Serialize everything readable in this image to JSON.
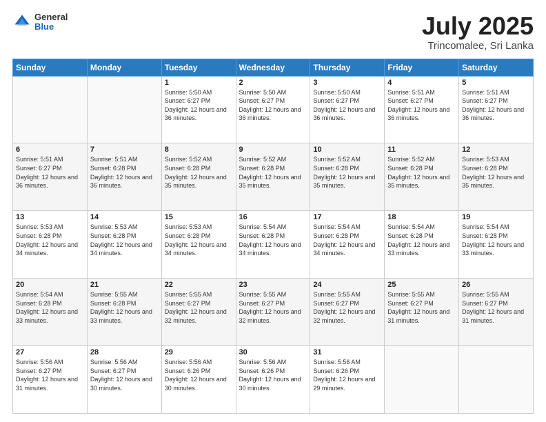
{
  "header": {
    "logo": {
      "line1": "General",
      "line2": "Blue"
    },
    "title": "July 2025",
    "subtitle": "Trincomalee, Sri Lanka"
  },
  "weekdays": [
    "Sunday",
    "Monday",
    "Tuesday",
    "Wednesday",
    "Thursday",
    "Friday",
    "Saturday"
  ],
  "weeks": [
    [
      {
        "day": "",
        "info": ""
      },
      {
        "day": "",
        "info": ""
      },
      {
        "day": "1",
        "info": "Sunrise: 5:50 AM\nSunset: 6:27 PM\nDaylight: 12 hours and 36 minutes."
      },
      {
        "day": "2",
        "info": "Sunrise: 5:50 AM\nSunset: 6:27 PM\nDaylight: 12 hours and 36 minutes."
      },
      {
        "day": "3",
        "info": "Sunrise: 5:50 AM\nSunset: 6:27 PM\nDaylight: 12 hours and 36 minutes."
      },
      {
        "day": "4",
        "info": "Sunrise: 5:51 AM\nSunset: 6:27 PM\nDaylight: 12 hours and 36 minutes."
      },
      {
        "day": "5",
        "info": "Sunrise: 5:51 AM\nSunset: 6:27 PM\nDaylight: 12 hours and 36 minutes."
      }
    ],
    [
      {
        "day": "6",
        "info": "Sunrise: 5:51 AM\nSunset: 6:27 PM\nDaylight: 12 hours and 36 minutes."
      },
      {
        "day": "7",
        "info": "Sunrise: 5:51 AM\nSunset: 6:28 PM\nDaylight: 12 hours and 36 minutes."
      },
      {
        "day": "8",
        "info": "Sunrise: 5:52 AM\nSunset: 6:28 PM\nDaylight: 12 hours and 35 minutes."
      },
      {
        "day": "9",
        "info": "Sunrise: 5:52 AM\nSunset: 6:28 PM\nDaylight: 12 hours and 35 minutes."
      },
      {
        "day": "10",
        "info": "Sunrise: 5:52 AM\nSunset: 6:28 PM\nDaylight: 12 hours and 35 minutes."
      },
      {
        "day": "11",
        "info": "Sunrise: 5:52 AM\nSunset: 6:28 PM\nDaylight: 12 hours and 35 minutes."
      },
      {
        "day": "12",
        "info": "Sunrise: 5:53 AM\nSunset: 6:28 PM\nDaylight: 12 hours and 35 minutes."
      }
    ],
    [
      {
        "day": "13",
        "info": "Sunrise: 5:53 AM\nSunset: 6:28 PM\nDaylight: 12 hours and 34 minutes."
      },
      {
        "day": "14",
        "info": "Sunrise: 5:53 AM\nSunset: 6:28 PM\nDaylight: 12 hours and 34 minutes."
      },
      {
        "day": "15",
        "info": "Sunrise: 5:53 AM\nSunset: 6:28 PM\nDaylight: 12 hours and 34 minutes."
      },
      {
        "day": "16",
        "info": "Sunrise: 5:54 AM\nSunset: 6:28 PM\nDaylight: 12 hours and 34 minutes."
      },
      {
        "day": "17",
        "info": "Sunrise: 5:54 AM\nSunset: 6:28 PM\nDaylight: 12 hours and 34 minutes."
      },
      {
        "day": "18",
        "info": "Sunrise: 5:54 AM\nSunset: 6:28 PM\nDaylight: 12 hours and 33 minutes."
      },
      {
        "day": "19",
        "info": "Sunrise: 5:54 AM\nSunset: 6:28 PM\nDaylight: 12 hours and 33 minutes."
      }
    ],
    [
      {
        "day": "20",
        "info": "Sunrise: 5:54 AM\nSunset: 6:28 PM\nDaylight: 12 hours and 33 minutes."
      },
      {
        "day": "21",
        "info": "Sunrise: 5:55 AM\nSunset: 6:28 PM\nDaylight: 12 hours and 33 minutes."
      },
      {
        "day": "22",
        "info": "Sunrise: 5:55 AM\nSunset: 6:27 PM\nDaylight: 12 hours and 32 minutes."
      },
      {
        "day": "23",
        "info": "Sunrise: 5:55 AM\nSunset: 6:27 PM\nDaylight: 12 hours and 32 minutes."
      },
      {
        "day": "24",
        "info": "Sunrise: 5:55 AM\nSunset: 6:27 PM\nDaylight: 12 hours and 32 minutes."
      },
      {
        "day": "25",
        "info": "Sunrise: 5:55 AM\nSunset: 6:27 PM\nDaylight: 12 hours and 31 minutes."
      },
      {
        "day": "26",
        "info": "Sunrise: 5:55 AM\nSunset: 6:27 PM\nDaylight: 12 hours and 31 minutes."
      }
    ],
    [
      {
        "day": "27",
        "info": "Sunrise: 5:56 AM\nSunset: 6:27 PM\nDaylight: 12 hours and 31 minutes."
      },
      {
        "day": "28",
        "info": "Sunrise: 5:56 AM\nSunset: 6:27 PM\nDaylight: 12 hours and 30 minutes."
      },
      {
        "day": "29",
        "info": "Sunrise: 5:56 AM\nSunset: 6:26 PM\nDaylight: 12 hours and 30 minutes."
      },
      {
        "day": "30",
        "info": "Sunrise: 5:56 AM\nSunset: 6:26 PM\nDaylight: 12 hours and 30 minutes."
      },
      {
        "day": "31",
        "info": "Sunrise: 5:56 AM\nSunset: 6:26 PM\nDaylight: 12 hours and 29 minutes."
      },
      {
        "day": "",
        "info": ""
      },
      {
        "day": "",
        "info": ""
      }
    ]
  ]
}
